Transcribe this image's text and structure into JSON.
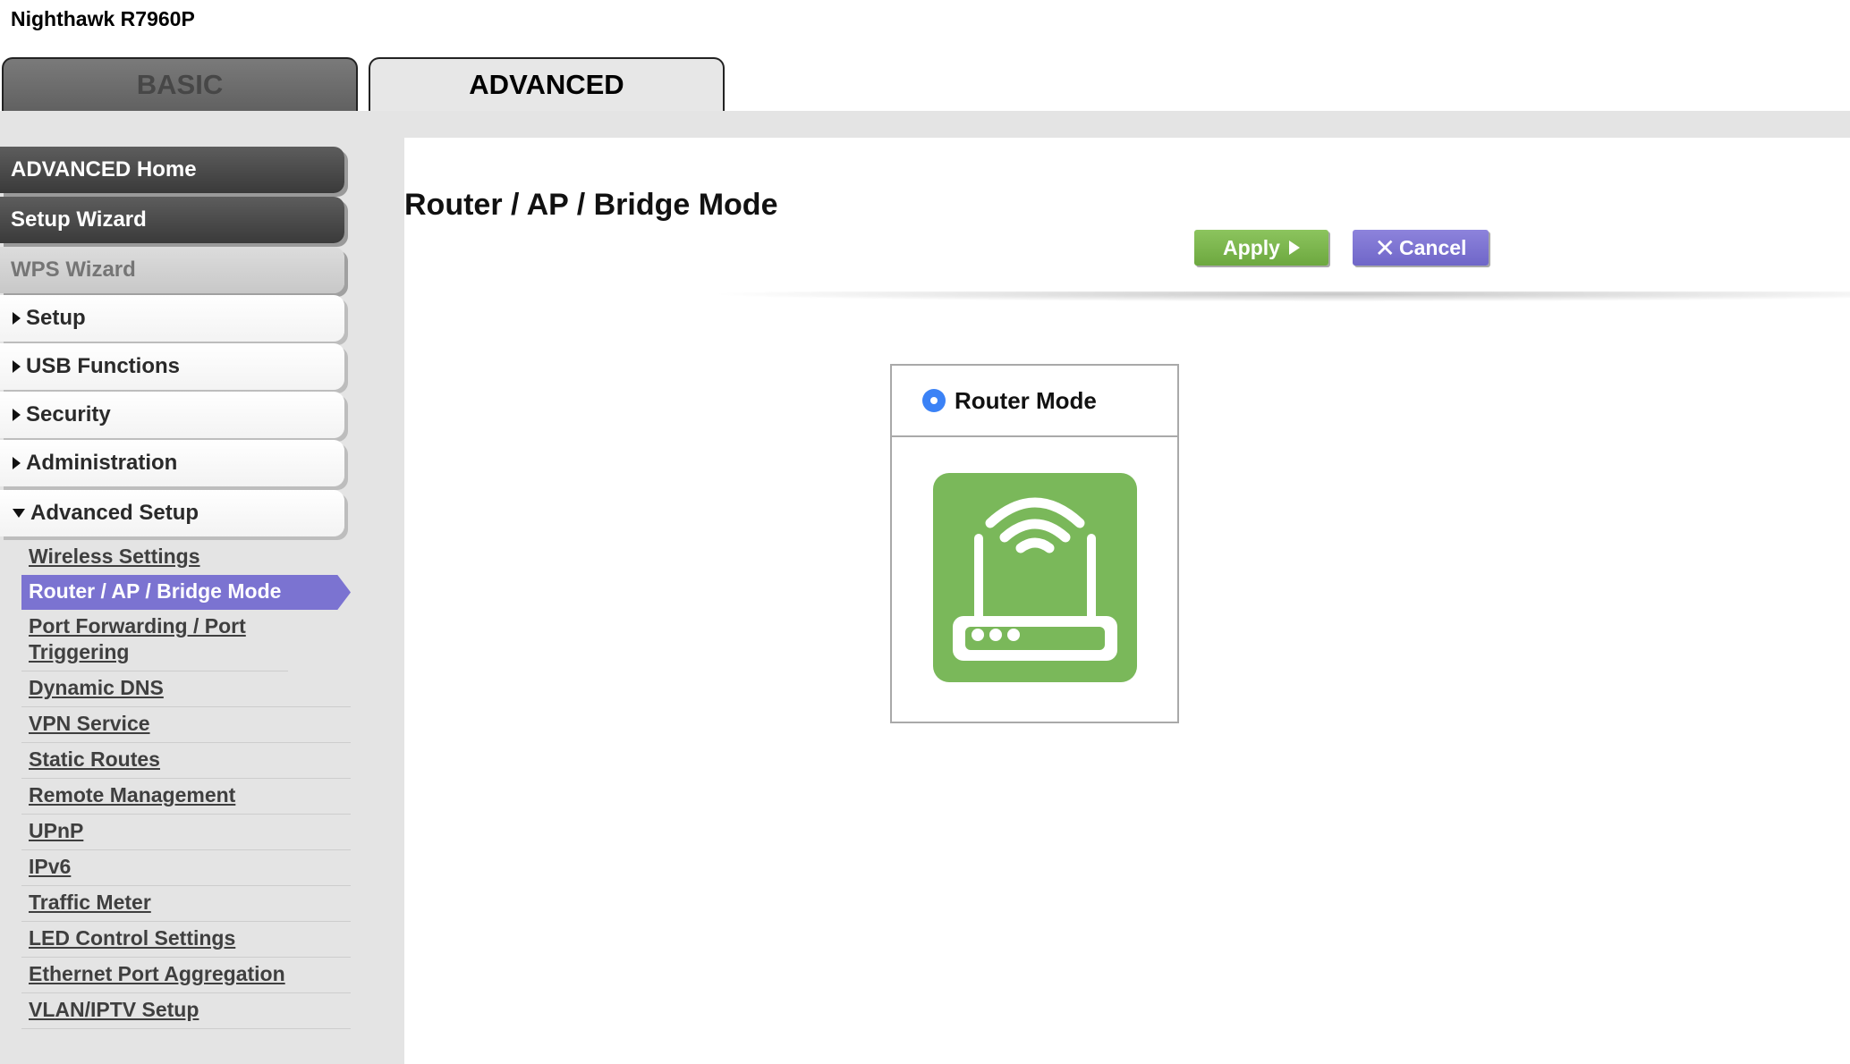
{
  "header": {
    "model": "Nighthawk R7960P"
  },
  "tabs": [
    {
      "label": "BASIC",
      "active": false
    },
    {
      "label": "ADVANCED",
      "active": true
    }
  ],
  "sidebar": {
    "buttons": [
      {
        "label": "ADVANCED Home"
      },
      {
        "label": "Setup Wizard"
      },
      {
        "label": "WPS Wizard"
      },
      {
        "label": "Setup"
      },
      {
        "label": "USB Functions"
      },
      {
        "label": "Security"
      },
      {
        "label": "Administration"
      },
      {
        "label": "Advanced Setup"
      }
    ],
    "subitems": [
      "Wireless Settings",
      "Router / AP / Bridge Mode",
      "Port Forwarding / Port Triggering",
      "Dynamic DNS",
      "VPN Service",
      "Static Routes",
      "Remote Management",
      "UPnP",
      "IPv6",
      "Traffic Meter",
      "LED Control Settings",
      "Ethernet Port Aggregation",
      "VLAN/IPTV Setup"
    ]
  },
  "main": {
    "title": "Router / AP / Bridge Mode",
    "apply_label": "Apply",
    "cancel_label": "Cancel",
    "mode_option": {
      "label": "Router Mode",
      "selected": true
    }
  },
  "colors": {
    "apply": "#7ab74c",
    "cancel": "#7b73d1",
    "active_nav": "#7b73d1",
    "router_icon_bg": "#7ab85a",
    "radio": "#3b82f6"
  },
  "icons": [
    "router-icon",
    "radio-selected-icon",
    "play-arrow-icon",
    "close-x-icon"
  ]
}
